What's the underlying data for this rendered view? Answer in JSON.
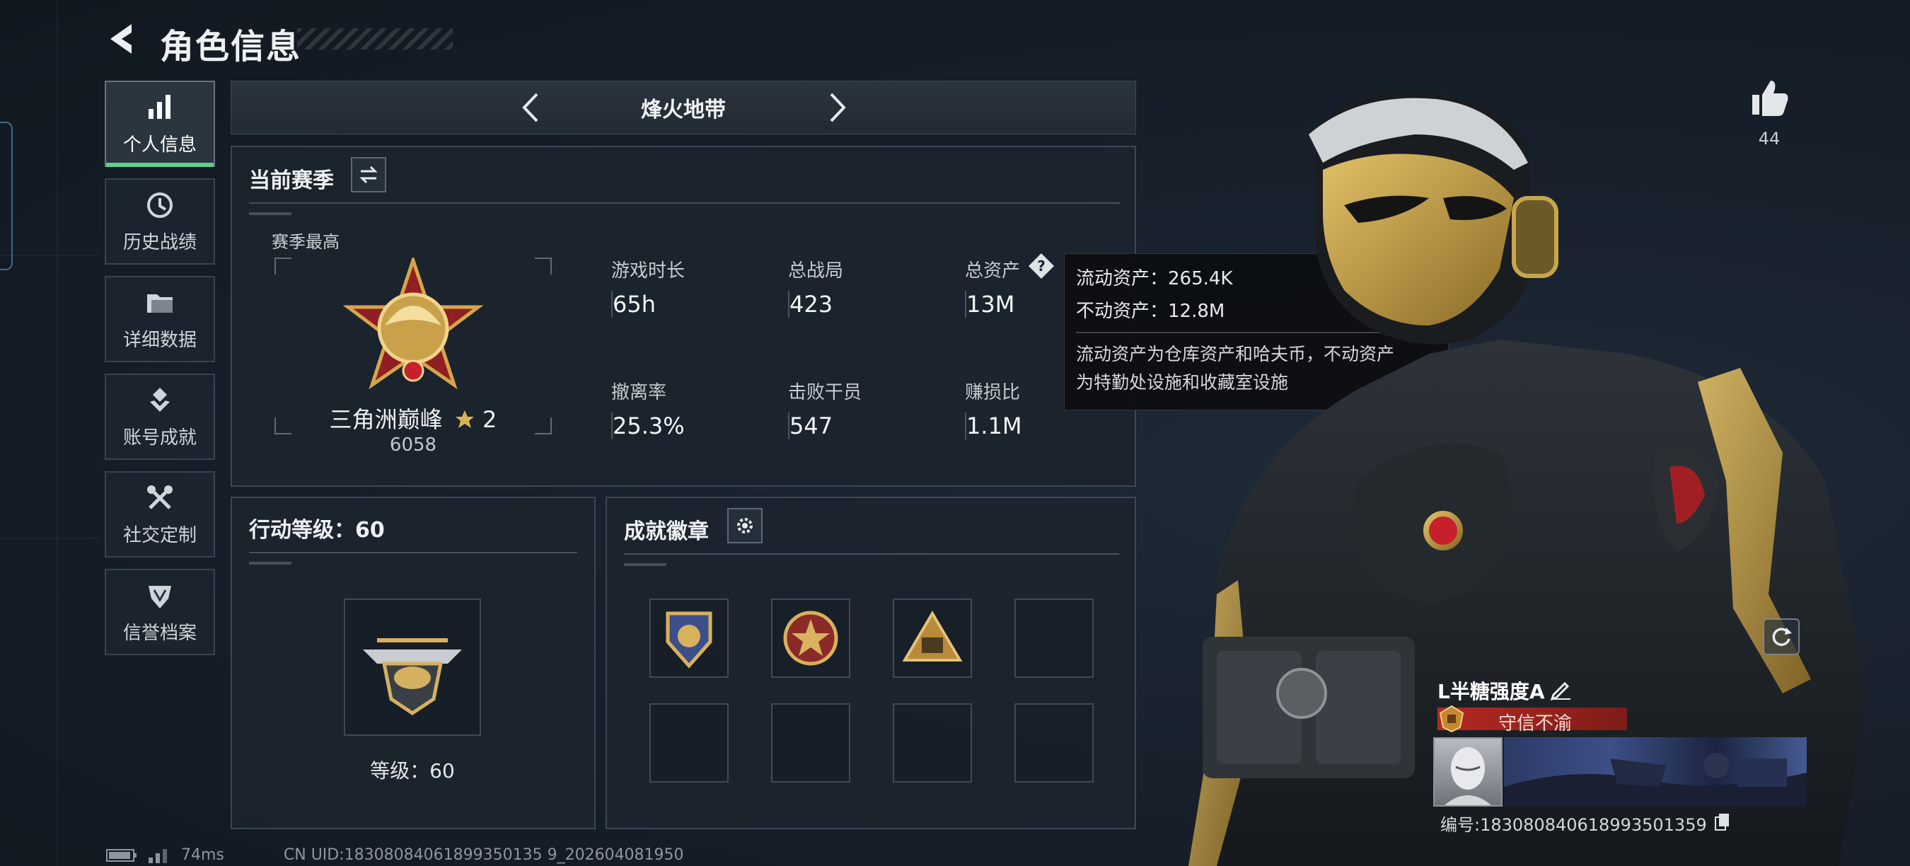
{
  "header": {
    "title": "角色信息"
  },
  "sidebar": {
    "items": [
      {
        "label": "个人信息",
        "icon": "bar-chart-icon",
        "active": true
      },
      {
        "label": "历史战绩",
        "icon": "history-icon"
      },
      {
        "label": "详细数据",
        "icon": "folder-icon"
      },
      {
        "label": "账号成就",
        "icon": "achievement-icon"
      },
      {
        "label": "社交定制",
        "icon": "tools-icon"
      },
      {
        "label": "信誉档案",
        "icon": "shield-icon"
      }
    ],
    "accent_color": "#5fd18a"
  },
  "mode": {
    "name": "烽火地带"
  },
  "season": {
    "title": "当前赛季",
    "best_label": "赛季最高",
    "rank_name": "三角洲巅峰",
    "rank_stars": "2",
    "rank_score": "6058",
    "stats": [
      {
        "label": "游戏时长",
        "value": "65h"
      },
      {
        "label": "总战局",
        "value": "423"
      },
      {
        "label": "总资产",
        "value": "13M"
      },
      {
        "label": "撤离率",
        "value": "25.3%"
      },
      {
        "label": "击败干员",
        "value": "547"
      },
      {
        "label": "赚损比",
        "value": "1.1M"
      }
    ]
  },
  "tooltip": {
    "liquid": "流动资产：265.4K",
    "fixed": "不动资产：12.8M",
    "desc_line1": "流动资产为仓库资产和哈夫币，不动资产",
    "desc_line2": "为特勤处设施和收藏室设施"
  },
  "action_level": {
    "title": "行动等级：60",
    "level_text": "等级：60"
  },
  "badges": {
    "title": "成就徽章",
    "slots": [
      "crest-badge-1",
      "star-badge",
      "soldier-badge",
      "",
      "",
      "",
      "",
      ""
    ]
  },
  "footer": {
    "ping": "74ms",
    "uid": "CN UID:18308084061899350135 9_202604081950"
  },
  "character": {
    "likes": "44",
    "player_name": "L半糖强度A",
    "reputation": "守信不渝",
    "player_id": "编号:183080840618993501359"
  }
}
